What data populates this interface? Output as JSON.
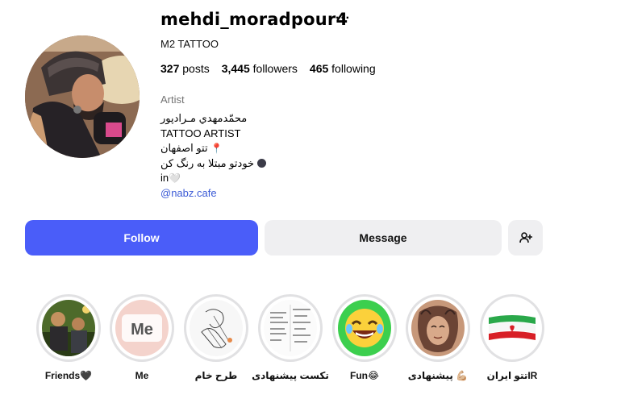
{
  "profile": {
    "username": "mehdi_moradpour4",
    "more_label": "···",
    "full_name": "M2 TATTOO",
    "stats": {
      "posts_count": "327",
      "posts_label": "posts",
      "followers_count": "3,445",
      "followers_label": "followers",
      "following_count": "465",
      "following_label": "following"
    },
    "category": "Artist",
    "bio": {
      "line1": "محمّدمهدي مـرادپور",
      "line2": "TATTOO ARTIST",
      "line3_text": "تتو اصفهان",
      "line3_emoji": "📍",
      "line4_text": "خودتو مبتلا به رنگ کن",
      "line5_text": "in",
      "line5_emoji": "🤍",
      "link": "@nabz.cafe"
    }
  },
  "actions": {
    "follow_label": "Follow",
    "message_label": "Message",
    "add_user_icon": "person-plus-icon"
  },
  "highlights": [
    {
      "label": "Friends🖤",
      "icon": "friends-photo"
    },
    {
      "label": "Me",
      "icon": "me-text"
    },
    {
      "label": "طرح خام",
      "icon": "sketch-drawing"
    },
    {
      "label": "تکست پیشنهادی",
      "icon": "text-samples"
    },
    {
      "label": "Fun😂",
      "icon": "laughing-emoji"
    },
    {
      "label": "پیشنهادی 💪🏼",
      "icon": "tattoo-portrait"
    },
    {
      "label": "تتو ایرانIR",
      "icon": "iran-flag"
    }
  ],
  "colors": {
    "follow_button": "#4a5df9",
    "secondary_button": "#efeff1",
    "link": "#3c5bd6",
    "muted_text": "#737373",
    "highlight_ring": "#e1e1e3"
  }
}
